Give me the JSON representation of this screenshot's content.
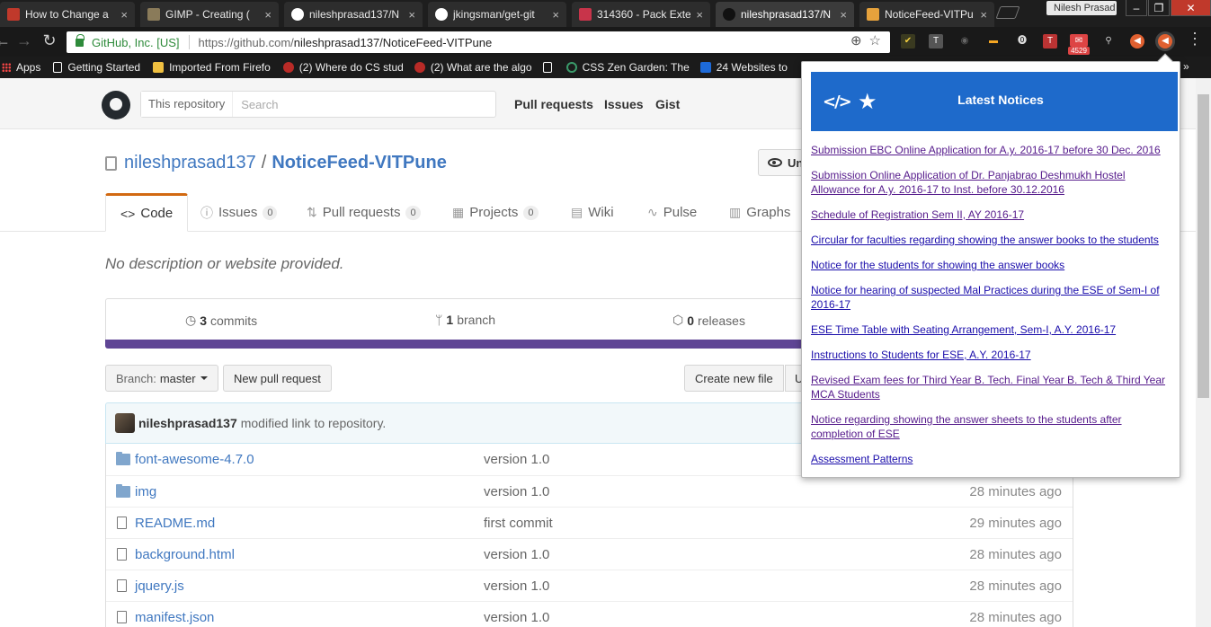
{
  "browser": {
    "tabs": [
      {
        "title": "How to Change a",
        "color": "#c0392b"
      },
      {
        "title": "GIMP - Creating (",
        "color": "#8a7b5a"
      },
      {
        "title": "nileshprasad137/N",
        "color": "#ffffff"
      },
      {
        "title": "jkingsman/get-git",
        "color": "#ffffff"
      },
      {
        "title": "314360 - Pack Exte",
        "color": "#c8344a"
      },
      {
        "title": "nileshprasad137/N",
        "color": "#ffffff"
      },
      {
        "title": "NoticeFeed-VITPu",
        "color": "#e6a23c"
      }
    ],
    "profile_name": "Nilesh Prasad",
    "secure_label": "GitHub, Inc. [US]",
    "url_host": "https://github.com/",
    "url_path": "nileshprasad137/NoticeFeed-VITPune",
    "extension_badge": "4529",
    "bookmarks": [
      {
        "label": "Apps",
        "color": ""
      },
      {
        "label": "Getting Started",
        "color": "#ffffff"
      },
      {
        "label": "Imported From Firefo",
        "color": "#f0c040"
      },
      {
        "label": "(2) Where do CS stud",
        "color": "#b92b27"
      },
      {
        "label": "(2) What are the algo",
        "color": "#b92b27"
      },
      {
        "label": "",
        "color": "#ffffff"
      },
      {
        "label": "CSS Zen Garden: The",
        "color": "#3a9a6a"
      },
      {
        "label": "24 Websites to",
        "color": "#1d6ad8"
      }
    ]
  },
  "github": {
    "search_scope": "This repository",
    "search_placeholder": "Search",
    "nav": [
      "Pull requests",
      "Issues",
      "Gist"
    ],
    "owner": "nileshprasad137",
    "repo": "NoticeFeed-VITPune",
    "watch_label": "Un",
    "tabs": [
      {
        "label": "Code",
        "icon": "<>",
        "count": ""
      },
      {
        "label": "Issues",
        "icon": "ⓘ",
        "count": "0"
      },
      {
        "label": "Pull requests",
        "icon": "⇅",
        "count": "0"
      },
      {
        "label": "Projects",
        "icon": "▦",
        "count": "0"
      },
      {
        "label": "Wiki",
        "icon": "▤",
        "count": ""
      },
      {
        "label": "Pulse",
        "icon": "∿",
        "count": ""
      },
      {
        "label": "Graphs",
        "icon": "▥",
        "count": ""
      }
    ],
    "description": "No description or website provided.",
    "summary": {
      "commits_num": "3",
      "commits_label": "commits",
      "branch_num": "1",
      "branch_label": "branch",
      "releases_num": "0",
      "releases_label": "releases"
    },
    "language_color": "#5f4595",
    "branch_prefix": "Branch:",
    "branch_name": "master",
    "new_pr_label": "New pull request",
    "create_file_label": "Create new file",
    "upload_label": "U",
    "commit_author": "nileshprasad137",
    "commit_message": "modified link to repository.",
    "files": [
      {
        "name": "font-awesome-4.7.0",
        "type": "dir",
        "message": "version 1.0",
        "age": ""
      },
      {
        "name": "img",
        "type": "dir",
        "message": "version 1.0",
        "age": "28 minutes ago"
      },
      {
        "name": "README.md",
        "type": "file",
        "message": "first commit",
        "age": "29 minutes ago"
      },
      {
        "name": "background.html",
        "type": "file",
        "message": "version 1.0",
        "age": "28 minutes ago"
      },
      {
        "name": "jquery.js",
        "type": "file",
        "message": "version 1.0",
        "age": "28 minutes ago"
      },
      {
        "name": "manifest.json",
        "type": "file",
        "message": "version 1.0",
        "age": "28 minutes ago"
      }
    ]
  },
  "popup": {
    "title": "Latest Notices",
    "header_color": "#1e6acb",
    "notices": [
      {
        "text": "Submission EBC Online Application for A.y. 2016-17 before 30 Dec. 2016",
        "visited": true
      },
      {
        "text": "Submission Online Application of Dr. Panjabrao Deshmukh Hostel Allowance for A.y. 2016-17 to Inst. before 30.12.2016",
        "visited": true
      },
      {
        "text": "Schedule of Registration Sem II, AY 2016-17",
        "visited": true
      },
      {
        "text": "Circular for faculties regarding showing the answer books to the students",
        "visited": false
      },
      {
        "text": "Notice for the students for showing the answer books",
        "visited": false
      },
      {
        "text": "Notice for hearing of suspected Mal Practices during the ESE of Sem-I of 2016-17",
        "visited": false
      },
      {
        "text": "ESE Time Table with Seating Arrangement, Sem-I, A.Y. 2016-17",
        "visited": false
      },
      {
        "text": "Instructions to Students for ESE, A.Y. 2016-17",
        "visited": false
      },
      {
        "text": "Revised Exam fees for Third Year B. Tech. Final Year B. Tech & Third Year MCA Students",
        "visited": true
      },
      {
        "text": "Notice regarding showing the answer sheets to the students after completion of ESE",
        "visited": true
      },
      {
        "text": "Assessment Patterns",
        "visited": false
      }
    ]
  }
}
